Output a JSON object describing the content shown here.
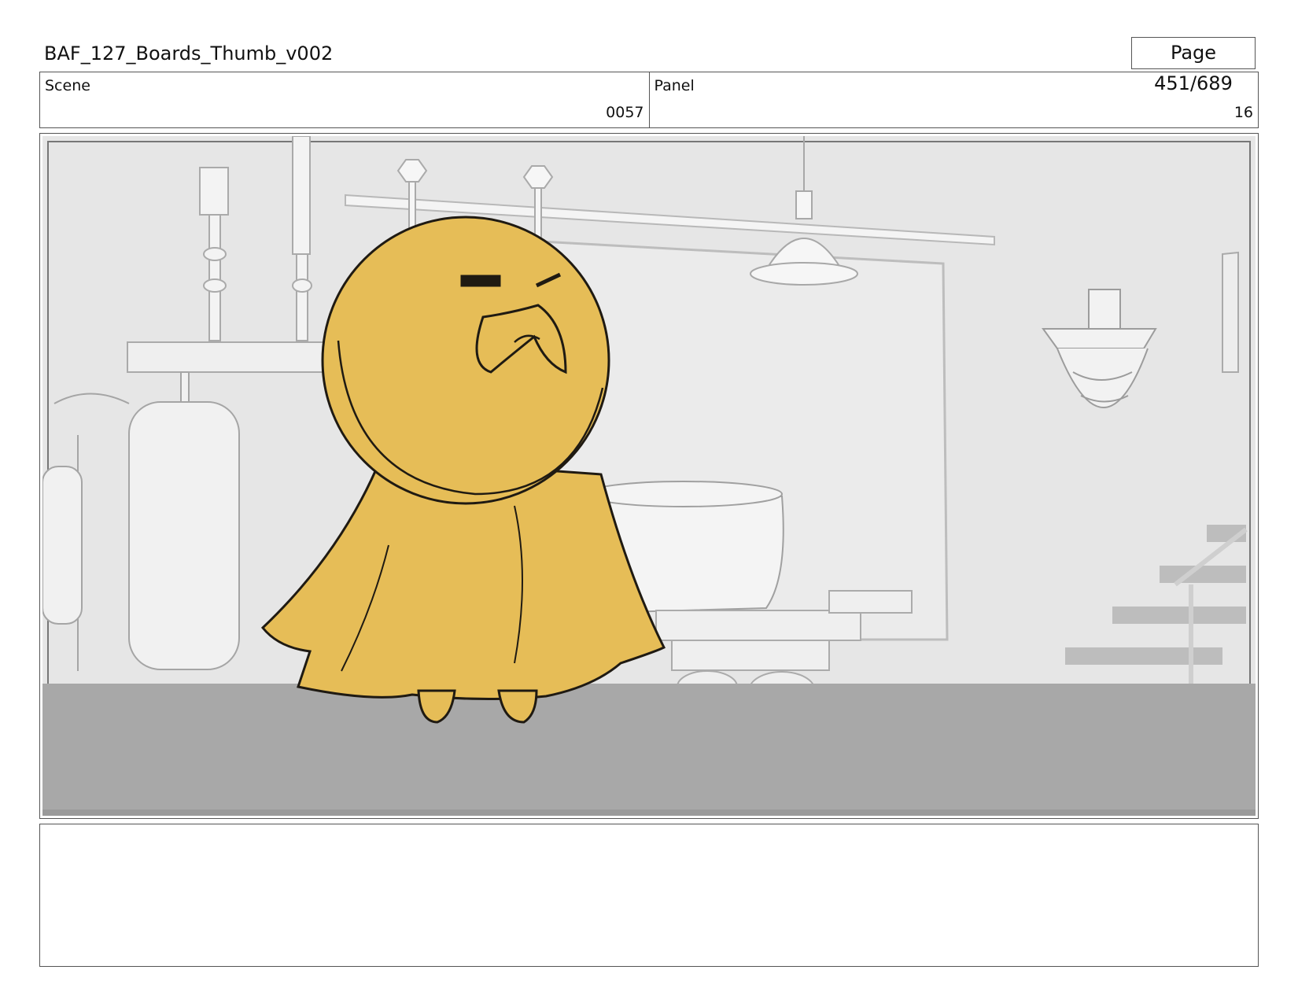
{
  "header": {
    "title": "BAF_127_Boards_Thumb_v002",
    "page": "Page 451/689"
  },
  "scene": {
    "label": "Scene",
    "value": "0057"
  },
  "panel": {
    "label": "Panel",
    "value": "16"
  },
  "colors": {
    "character": "#e6bd57",
    "outline": "#1f1a12",
    "wall": "#e8e8e8",
    "floor": "#a9a9a9",
    "props": "#f2f2f2"
  },
  "icons": [
    "storyboard-frame",
    "hooded-character",
    "lamp",
    "candlestick",
    "cauldron",
    "gas-tank",
    "staircase",
    "wall-ornament"
  ],
  "notes": ""
}
